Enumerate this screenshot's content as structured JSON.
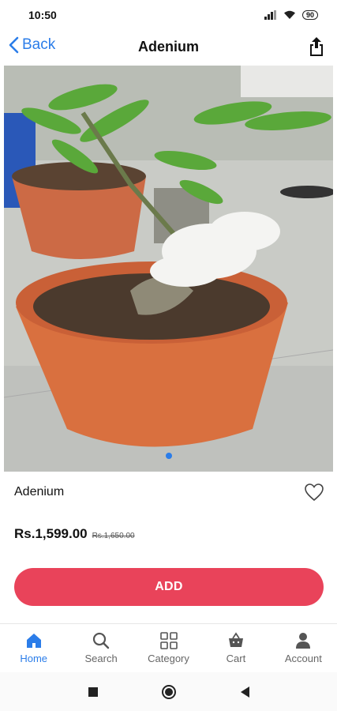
{
  "status_bar": {
    "time": "10:50",
    "battery": "90",
    "icons": [
      "signal-icon",
      "wifi-icon",
      "battery-icon"
    ]
  },
  "header": {
    "back_label": "Back",
    "title": "Adenium",
    "share_icon": "share-icon"
  },
  "hero": {
    "description_icon": "product-photo",
    "pager": {
      "count": 1,
      "active": 0
    }
  },
  "product": {
    "name": "Adenium",
    "price": "Rs.1,599.00",
    "old_price": "Rs.1,650.00",
    "wishlist_icon": "heart-outline-icon"
  },
  "actions": {
    "add_label": "ADD",
    "add_color": "#e9435a"
  },
  "tabbar": {
    "items": [
      {
        "label": "Home",
        "icon": "home-icon",
        "active": true
      },
      {
        "label": "Search",
        "icon": "search-icon",
        "active": false
      },
      {
        "label": "Category",
        "icon": "grid-icon",
        "active": false
      },
      {
        "label": "Cart",
        "icon": "basket-icon",
        "active": false
      },
      {
        "label": "Account",
        "icon": "person-icon",
        "active": false
      }
    ]
  },
  "colors": {
    "accent": "#2b7de9",
    "primary_button": "#e9435a",
    "inactive_tab": "#666666"
  }
}
